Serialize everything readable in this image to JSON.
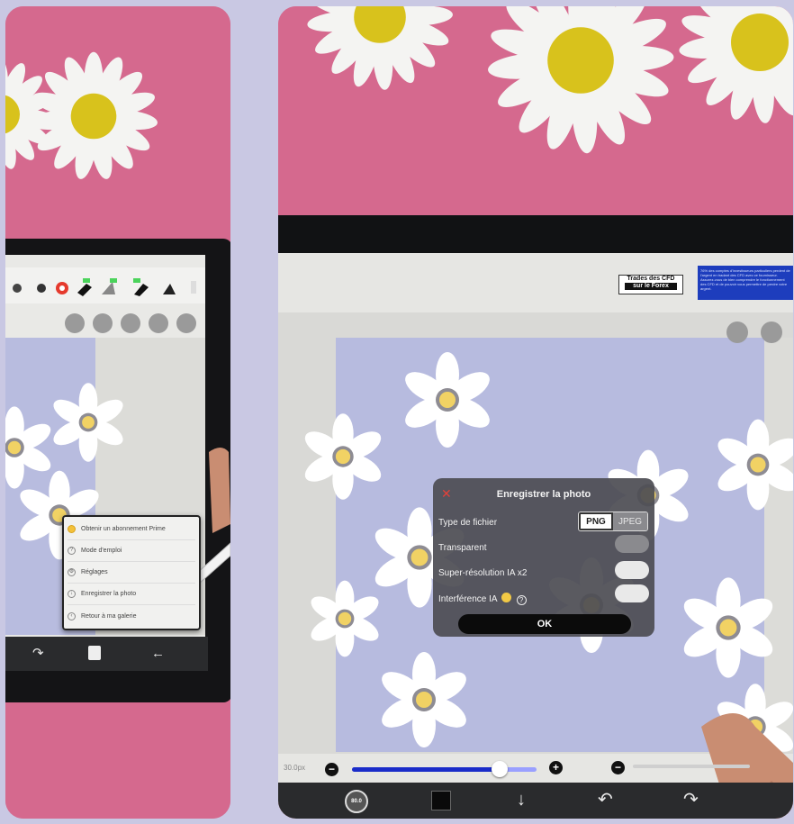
{
  "left_photo": {
    "menu_items": [
      {
        "label": "Obtenir un abonnement Prime",
        "icon": "crown-icon"
      },
      {
        "label": "Mode d'emploi",
        "icon": "help-icon"
      },
      {
        "label": "Réglages",
        "icon": "gear-icon"
      },
      {
        "label": "Enregistrer la photo",
        "icon": "download-icon"
      },
      {
        "label": "Retour à ma galerie",
        "icon": "back-icon"
      }
    ]
  },
  "right_photo": {
    "ads": {
      "box1_line1": "Trades des CFD",
      "box1_line2": "sur le Forex",
      "box2_text": "76% des comptes d'investisseurs particuliers perdent de l'argent en tradant des CFD avec ce fournisseur. Assurez-vous de bien comprendre le fonctionnement des CFD et de pouvoir vous permettre de perdre votre argent."
    },
    "dialog": {
      "title": "Enregistrer la photo",
      "file_type_label": "Type de fichier",
      "file_type_options": [
        "PNG",
        "JPEG"
      ],
      "file_type_selected": "PNG",
      "transparent_label": "Transparent",
      "super_resolution_label": "Super-résolution IA x2",
      "interference_label": "Interférence IA",
      "help_glyph": "?",
      "ok_label": "OK"
    },
    "slider": {
      "zoom_label": "30.0px",
      "level": 0.8
    },
    "bottom_bar": {
      "avatar_text": "80.0",
      "down_icon": "↓",
      "undo_icon": "↶",
      "redo_icon": "↷"
    }
  },
  "colors": {
    "background": "#c9c8e3",
    "pink": "#d5698e",
    "canvas": "#b7bbdf",
    "accent_blue": "#1a2cc9"
  }
}
